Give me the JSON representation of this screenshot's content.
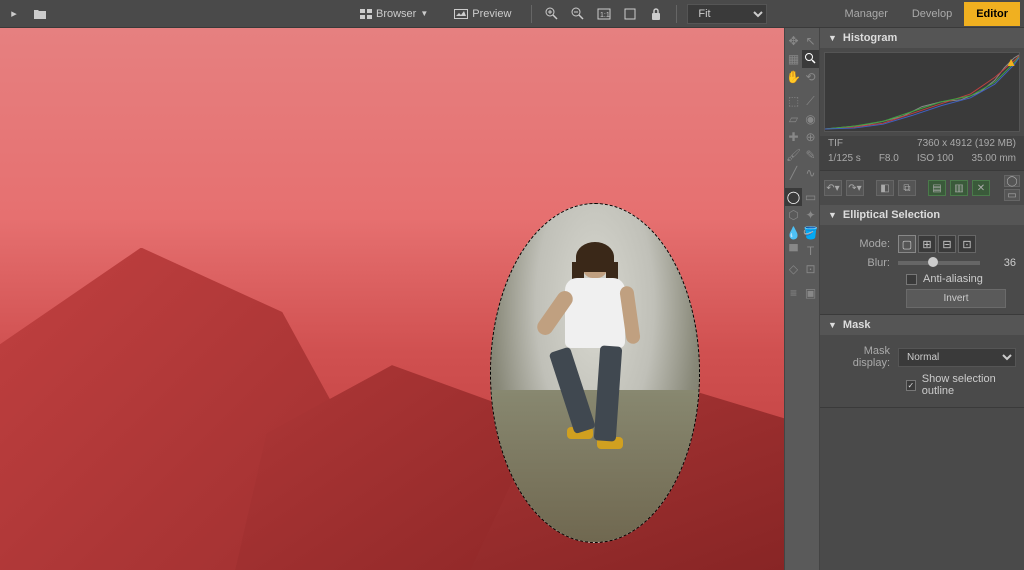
{
  "toolbar": {
    "browser_label": "Browser",
    "preview_label": "Preview",
    "zoom_value": "Fit"
  },
  "tabs": {
    "manager": "Manager",
    "develop": "Develop",
    "editor": "Editor"
  },
  "metadata": {
    "format": "TIF",
    "dimensions": "7360 x 4912 (192 MB)",
    "shutter": "1/125 s",
    "aperture": "F8.0",
    "iso": "ISO 100",
    "focal": "35.00 mm"
  },
  "panels": {
    "histogram_title": "Histogram",
    "elliptical": {
      "title": "Elliptical Selection",
      "mode_label": "Mode:",
      "blur_label": "Blur:",
      "blur_value": "36",
      "antialias_label": "Anti-aliasing",
      "invert_label": "Invert"
    },
    "mask": {
      "title": "Mask",
      "display_label": "Mask display:",
      "display_value": "Normal",
      "outline_label": "Show selection outline"
    }
  }
}
